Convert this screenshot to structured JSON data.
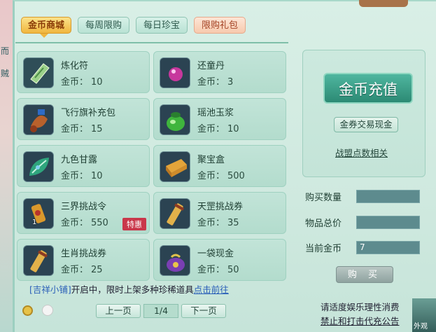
{
  "left_strip": {
    "chars": [
      "而",
      "贼"
    ]
  },
  "tabs": [
    {
      "label": "金币商城",
      "state": "active"
    },
    {
      "label": "每周限购",
      "state": "normal"
    },
    {
      "label": "每日珍宝",
      "state": "normal"
    },
    {
      "label": "限购礼包",
      "state": "pink"
    }
  ],
  "price_label": "金币：",
  "items": [
    {
      "name": "炼化符",
      "price": "10",
      "icon": "talisman-icon"
    },
    {
      "name": "还童丹",
      "price": "3",
      "icon": "purple-pill-icon"
    },
    {
      "name": "飞行旗补充包",
      "price": "15",
      "icon": "flag-pack-icon"
    },
    {
      "name": "瑶池玉浆",
      "price": "10",
      "icon": "jade-jar-icon"
    },
    {
      "name": "九色甘露",
      "price": "10",
      "icon": "dew-leaf-icon"
    },
    {
      "name": "聚宝盒",
      "price": "500",
      "icon": "treasure-box-icon"
    },
    {
      "name": "三界挑战令",
      "price": "550",
      "icon": "challenge-token-icon",
      "count": "1",
      "badge": "特惠"
    },
    {
      "name": "天罡挑战券",
      "price": "35",
      "icon": "scroll-icon"
    },
    {
      "name": "生肖挑战券",
      "price": "25",
      "icon": "scroll-icon"
    },
    {
      "name": "一袋现金",
      "price": "50",
      "icon": "money-bag-icon"
    }
  ],
  "notice": {
    "tag": "[吉祥小铺]",
    "text": "开启中，限时上架多种珍稀道具",
    "link": "点击前往"
  },
  "side": {
    "recharge": "金币充值",
    "trade": "金券交易现金",
    "alliance": "战盟点数相关"
  },
  "form": {
    "qty_label": "购买数量",
    "qty_value": "",
    "total_label": "物品总价",
    "total_value": "",
    "gold_label": "当前金币",
    "gold_value": "7",
    "buy": "购 买"
  },
  "pager": {
    "prev": "上一页",
    "page": "1/4",
    "next": "下一页"
  },
  "legal": {
    "line1": "请适度娱乐理性消费",
    "line2": "禁止和打击代充公告"
  },
  "corner_text": "外观",
  "colors": {
    "accent_gold": "#f0b63e",
    "teal_button": "#2c8a74",
    "badge_red": "#c9374a",
    "link_blue": "#2a5fb8"
  }
}
